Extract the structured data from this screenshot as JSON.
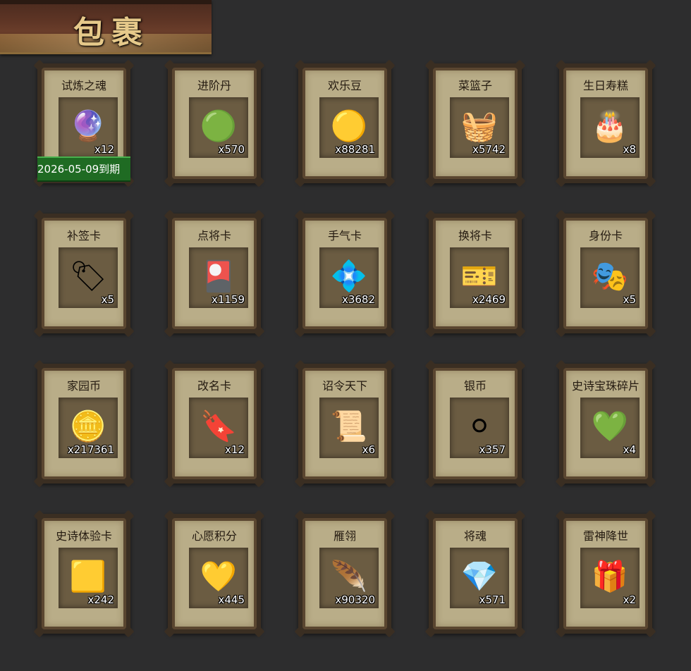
{
  "title": "包裹",
  "items": [
    {
      "name": "试炼之魂",
      "count": "x12",
      "icon": "purple-dragon-orb",
      "glyph": "🔮"
    },
    {
      "name": "进阶丹",
      "count": "x570",
      "icon": "green-pill",
      "glyph": "🟢"
    },
    {
      "name": "欢乐豆",
      "count": "x88281",
      "icon": "gold-beans",
      "glyph": "🟡"
    },
    {
      "name": "菜篮子",
      "count": "x5742",
      "icon": "flower-basket",
      "glyph": "🧺"
    },
    {
      "name": "生日寿糕",
      "count": "x8",
      "icon": "birthday-cake",
      "glyph": "🎂"
    },
    {
      "name": "补签卡",
      "count": "x5",
      "icon": "copper-tag",
      "glyph": "🏷"
    },
    {
      "name": "点将卡",
      "count": "x1159",
      "icon": "general-token",
      "glyph": "🎴"
    },
    {
      "name": "手气卡",
      "count": "x3682",
      "icon": "luck-ring-card",
      "glyph": "💠"
    },
    {
      "name": "换将卡",
      "count": "x2469",
      "icon": "swap-general-token",
      "glyph": "🎫"
    },
    {
      "name": "身份卡",
      "count": "x5",
      "icon": "mask-card",
      "glyph": "🎭"
    },
    {
      "name": "家园币",
      "count": "x217361",
      "icon": "home-coin",
      "glyph": "🪙"
    },
    {
      "name": "改名卡",
      "count": "x12",
      "icon": "rename-tag",
      "glyph": "🔖"
    },
    {
      "name": "诏令天下",
      "count": "x6",
      "icon": "edict-scroll",
      "glyph": "📜"
    },
    {
      "name": "银币",
      "count": "x357",
      "icon": "silver-coins",
      "glyph": "⚪"
    },
    {
      "name": "史诗宝珠碎片",
      "count": "x4",
      "icon": "green-gem-shard",
      "glyph": "💚"
    },
    {
      "name": "史诗体验卡",
      "count": "x242",
      "icon": "gold-card",
      "glyph": "🟨"
    },
    {
      "name": "心愿积分",
      "count": "x445",
      "icon": "heart-coin",
      "glyph": "💛"
    },
    {
      "name": "雁翎",
      "count": "x90320",
      "icon": "feather",
      "glyph": "🪶"
    },
    {
      "name": "将魂",
      "count": "x571",
      "icon": "green-crystal",
      "glyph": "💎"
    },
    {
      "name": "雷神降世",
      "count": "x2",
      "icon": "gift-box",
      "glyph": "🎁"
    }
  ],
  "expire_label": "2026-05-09到期"
}
